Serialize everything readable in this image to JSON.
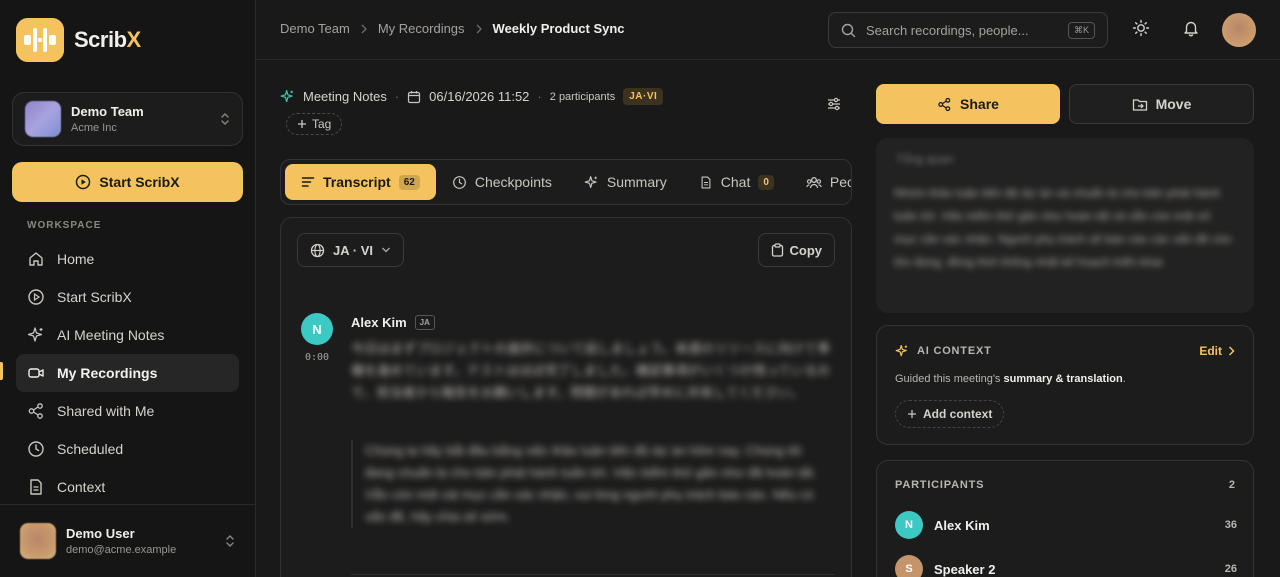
{
  "app": {
    "name_part1": "Scrib",
    "name_part2": "X"
  },
  "team": {
    "name": "Demo Team",
    "org": "Acme Inc"
  },
  "sidebar": {
    "start_label": "Start ScribX",
    "section_label": "WORKSPACE",
    "items": [
      {
        "label": "Home"
      },
      {
        "label": "Start ScribX"
      },
      {
        "label": "AI Meeting Notes"
      },
      {
        "label": "My Recordings"
      },
      {
        "label": "Shared with Me"
      },
      {
        "label": "Scheduled"
      },
      {
        "label": "Context"
      }
    ]
  },
  "user": {
    "name": "Demo User",
    "email": "demo@acme.example"
  },
  "breadcrumb": {
    "team": "Demo Team",
    "section": "My Recordings",
    "current": "Weekly Product Sync"
  },
  "search": {
    "placeholder": "Search recordings, people...",
    "shortcut": "⌘K"
  },
  "meta": {
    "type": "Meeting Notes",
    "datetime": "06/16/2026 11:52",
    "participants": "2 participants",
    "languages": "JA·VI",
    "tag_label": "Tag"
  },
  "tabs": [
    {
      "label": "Transcript",
      "count": "62"
    },
    {
      "label": "Checkpoints"
    },
    {
      "label": "Summary"
    },
    {
      "label": "Chat",
      "count": "0"
    },
    {
      "label": "People"
    }
  ],
  "transcript": {
    "language": "JA · VI",
    "copy_label": "Copy",
    "speaker": "Alex Kim",
    "speaker_initial": "N",
    "speaker_lang": "JA",
    "timestamp": "0:00",
    "original": "今日はまずプロジェクトの進捗について話しましょう。来週のリリースに向けて準備を進めています。テストはほぼ完了しました。確認事項がいくつか残っているので、担当者から報告をお願いします。問題があれば早めに共有してください。",
    "translation": "Chúng ta hãy bắt đầu bằng việc thảo luận tiến độ dự án hôm nay. Chúng tôi đang chuẩn bị cho bản phát hành tuần tới. Việc kiểm thử gần như đã hoàn tất. Vẫn còn một vài mục cần xác nhận, vui lòng người phụ trách báo cáo. Nếu có vấn đề, hãy chia sẻ sớm."
  },
  "actions": {
    "share": "Share",
    "move": "Move"
  },
  "summary": {
    "title": "Tổng quan",
    "text": "Nhóm thảo luận tiến độ dự án và chuẩn bị cho bản phát hành tuần tới. Việc kiểm thử gần như hoàn tất và vẫn còn một số mục cần xác nhận. Người phụ trách sẽ báo cáo các vấn đề còn tồn đọng, đồng thời thống nhất kế hoạch triển khai."
  },
  "ai_context": {
    "title": "AI CONTEXT",
    "edit_label": "Edit",
    "desc_prefix": "Guided this meeting's ",
    "desc_bold": "summary & translation",
    "desc_suffix": ".",
    "add_label": "Add context"
  },
  "participants": {
    "title": "PARTICIPANTS",
    "total": "2",
    "list": [
      {
        "initial": "N",
        "name": "Alex Kim",
        "count": "36",
        "color": "#3cc8c3"
      },
      {
        "initial": "S",
        "name": "Speaker 2",
        "count": "26",
        "color": "#c4946a"
      }
    ]
  },
  "colors": {
    "accent": "#f4c35e",
    "background": "#191919",
    "sidebar": "#151515"
  }
}
